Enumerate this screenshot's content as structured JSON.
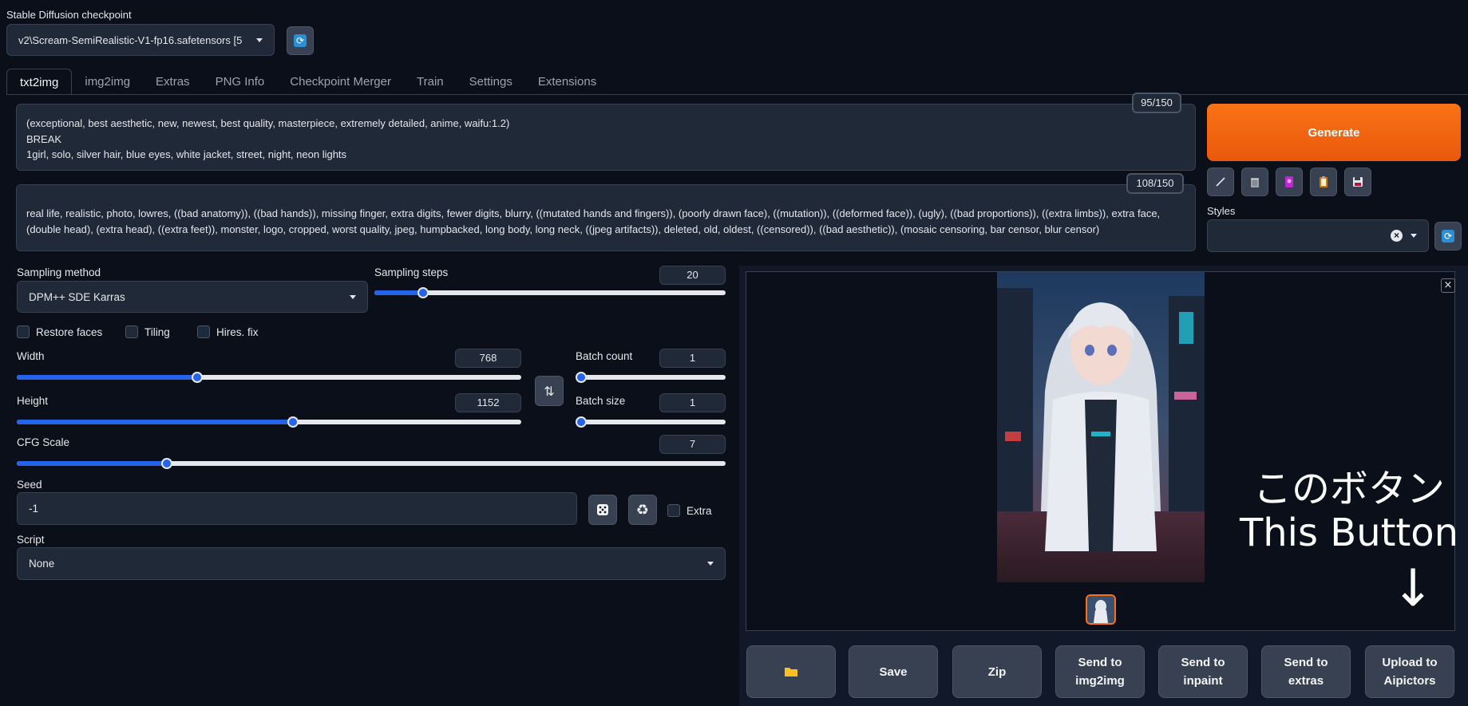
{
  "checkpoint": {
    "label": "Stable Diffusion checkpoint",
    "value": "v2\\Scream-SemiRealistic-V1-fp16.safetensors [5",
    "refresh_icon": "refresh-icon"
  },
  "tabs": [
    {
      "label": "txt2img",
      "active": true
    },
    {
      "label": "img2img"
    },
    {
      "label": "Extras"
    },
    {
      "label": "PNG Info"
    },
    {
      "label": "Checkpoint Merger"
    },
    {
      "label": "Train"
    },
    {
      "label": "Settings"
    },
    {
      "label": "Extensions"
    }
  ],
  "prompt": {
    "text": "(exceptional, best aesthetic, new, newest, best quality, masterpiece, extremely detailed, anime, waifu:1.2)\nBREAK\n1girl, solo, silver hair, blue eyes, white jacket, street, night, neon lights",
    "counter": "95/150"
  },
  "negative_prompt": {
    "text": "real life, realistic, photo, lowres, ((bad anatomy)), ((bad hands)), missing finger, extra digits, fewer digits, blurry, ((mutated hands and fingers)), (poorly drawn face), ((mutation)), ((deformed face)), (ugly), ((bad proportions)), ((extra limbs)), extra face, (double head), (extra head), ((extra feet)), monster, logo, cropped, worst quality, jpeg, humpbacked, long body, long neck, ((jpeg artifacts)), deleted, old, oldest, ((censored)), ((bad aesthetic)), (mosaic censoring, bar censor, blur censor)",
    "counter": "108/150"
  },
  "generate_label": "Generate",
  "tools": [
    "pencil-icon",
    "trash-icon",
    "model-card-icon",
    "clipboard-icon",
    "save-disk-icon"
  ],
  "styles": {
    "label": "Styles",
    "clear": "×"
  },
  "sampling": {
    "method_label": "Sampling method",
    "method_value": "DPM++ SDE Karras",
    "steps_label": "Sampling steps",
    "steps_value": "20",
    "steps_min": 1,
    "steps_max": 150,
    "steps_num": 20
  },
  "checkboxes": {
    "restore_faces": "Restore faces",
    "tiling": "Tiling",
    "hires": "Hires. fix"
  },
  "width": {
    "label": "Width",
    "value": "768",
    "num": 768,
    "min": 64,
    "max": 2048
  },
  "height": {
    "label": "Height",
    "value": "1152",
    "num": 1152,
    "min": 64,
    "max": 2048
  },
  "swap_icon": "⇅",
  "batch_count": {
    "label": "Batch count",
    "value": "1",
    "num": 1,
    "min": 1,
    "max": 100
  },
  "batch_size": {
    "label": "Batch size",
    "value": "1",
    "num": 1,
    "min": 1,
    "max": 8
  },
  "cfg": {
    "label": "CFG Scale",
    "value": "7",
    "num": 7,
    "min": 1,
    "max": 30
  },
  "seed": {
    "label": "Seed",
    "value": "-1",
    "extra_label": "Extra"
  },
  "script": {
    "label": "Script",
    "value": "None"
  },
  "actions": {
    "folder_icon": "folder-icon",
    "save": "Save",
    "zip": "Zip",
    "send_img2img": "Send to\nimg2img",
    "send_inpaint": "Send to\ninpaint",
    "send_extras": "Send to\nextras",
    "upload": "Upload to\nAipictors"
  },
  "annotation": {
    "line1": "このボタン",
    "line2": "This Button",
    "arrow": "↓"
  },
  "colors": {
    "background": "#0b0f19",
    "panel": "#1f2937",
    "accent": "#2563eb",
    "generate": "#f97316"
  }
}
